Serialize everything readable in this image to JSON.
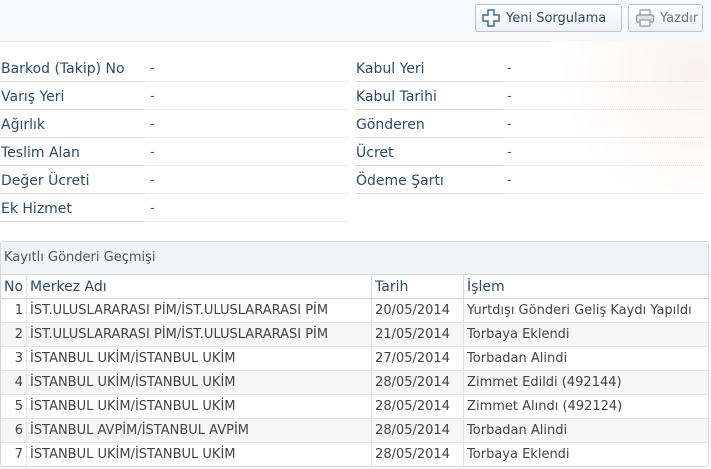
{
  "toolbar": {
    "new_query_label": "Yeni Sorgulama",
    "print_label": "Yazdır",
    "new_query_icon": "plus-icon",
    "print_icon": "printer-icon"
  },
  "details": {
    "left": [
      {
        "label": "Barkod (Takip) No",
        "value": "-"
      },
      {
        "label": "Varış Yeri",
        "value": "-"
      },
      {
        "label": "Ağırlık",
        "value": "-"
      },
      {
        "label": "Teslim Alan",
        "value": "-"
      },
      {
        "label": "Değer Ücreti",
        "value": "-"
      },
      {
        "label": "Ek Hizmet",
        "value": "-"
      }
    ],
    "right": [
      {
        "label": "Kabul Yeri",
        "value": "-"
      },
      {
        "label": "Kabul Tarihi",
        "value": "-"
      },
      {
        "label": "Gönderen",
        "value": "-"
      },
      {
        "label": "Ücret",
        "value": "-"
      },
      {
        "label": "Ödeme Şartı",
        "value": "-"
      }
    ]
  },
  "history": {
    "title": "Kayıtlı Gönderi Geçmişi",
    "columns": [
      "No",
      "Merkez Adı",
      "Tarih",
      "İşlem"
    ],
    "rows": [
      {
        "no": "1",
        "center": "İST.ULUSLARARASI PİM/İST.ULUSLARARASI PİM",
        "date": "20/05/2014",
        "action": "Yurtdışı Gönderi Geliş Kaydı Yapıldı"
      },
      {
        "no": "2",
        "center": "İST.ULUSLARARASI PİM/İST.ULUSLARARASI PİM",
        "date": "21/05/2014",
        "action": "Torbaya Eklendi"
      },
      {
        "no": "3",
        "center": "İSTANBUL UKİM/İSTANBUL UKİM",
        "date": "27/05/2014",
        "action": "Torbadan Alindi"
      },
      {
        "no": "4",
        "center": "İSTANBUL UKİM/İSTANBUL UKİM",
        "date": "28/05/2014",
        "action": "Zimmet Edildi (492144)"
      },
      {
        "no": "5",
        "center": "İSTANBUL UKİM/İSTANBUL UKİM",
        "date": "28/05/2014",
        "action": "Zimmet Alındı (492124)"
      },
      {
        "no": "6",
        "center": "İSTANBUL AVPİM/İSTANBUL AVPİM",
        "date": "28/05/2014",
        "action": "Torbadan Alindi"
      },
      {
        "no": "7",
        "center": "İSTANBUL UKİM/İSTANBUL UKİM",
        "date": "28/05/2014",
        "action": "Torbaya Eklendi"
      }
    ]
  }
}
